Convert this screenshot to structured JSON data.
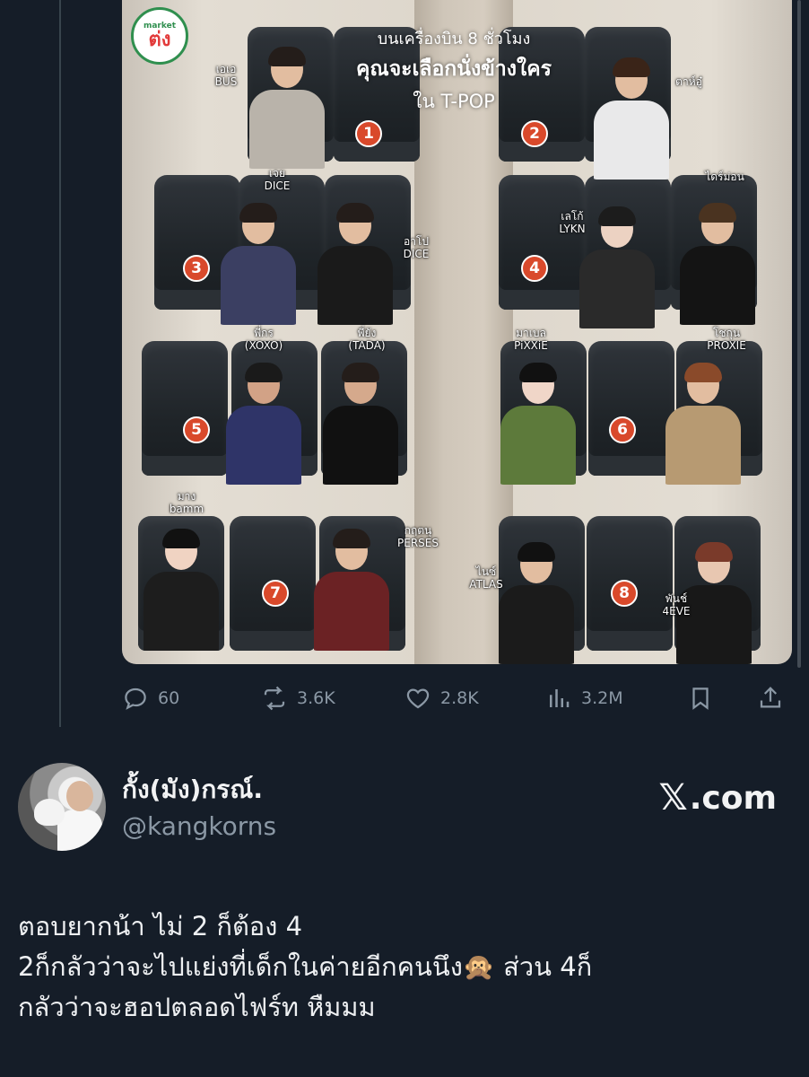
{
  "media": {
    "title_line1": "บนเครื่องบิน 8 ชั่วโมง",
    "title_line2": "คุณจะเลือกนั่งข้างใคร",
    "title_line3": "ใน T-POP",
    "logo_small": "market",
    "logo_main": "ต่ง",
    "seat_numbers": [
      "1",
      "2",
      "3",
      "4",
      "5",
      "6",
      "7",
      "8"
    ],
    "people": [
      {
        "name": "เอเอ",
        "group": "BUS"
      },
      {
        "name": "ตาห์อู๋",
        "group": ""
      },
      {
        "name": "เจย",
        "group": "DICE"
      },
      {
        "name": "อาโป",
        "group": "DICE"
      },
      {
        "name": "เลโก้",
        "group": "LYKN"
      },
      {
        "name": "ไดร์ม่อน",
        "group": ""
      },
      {
        "name": "พี่กร",
        "group": "(XOXO)"
      },
      {
        "name": "พี่ยัง",
        "group": "(TADA)"
      },
      {
        "name": "มาเบล",
        "group": "PiXXiE"
      },
      {
        "name": "โชกุน",
        "group": "PROXIE"
      },
      {
        "name": "มาง",
        "group": "bamm"
      },
      {
        "name": "กฤตนุ",
        "group": "PERSES"
      },
      {
        "name": "ไนซ์",
        "group": "ATLAS"
      },
      {
        "name": "พันช์",
        "group": "4EVE"
      }
    ]
  },
  "actions": {
    "replies": "60",
    "reposts": "3.6K",
    "likes": "2.8K",
    "views": "3.2M"
  },
  "author": {
    "display_name": "กั้ง(มัง)กรณ์.",
    "handle": "@kangkorns",
    "brand_mark": "𝕏",
    "brand_text": ".com"
  },
  "tweet": {
    "line1": "ตอบยากน้า ไม่ 2 ก็ต้อง 4",
    "line2": "2ก็กลัวว่าจะไปแย่งที่เด็กในค่ายอีกคนนึง🙊 ส่วน 4ก็",
    "line3": "กลัวว่าจะฮอปตลอดไฟร์ท หืมมม"
  }
}
